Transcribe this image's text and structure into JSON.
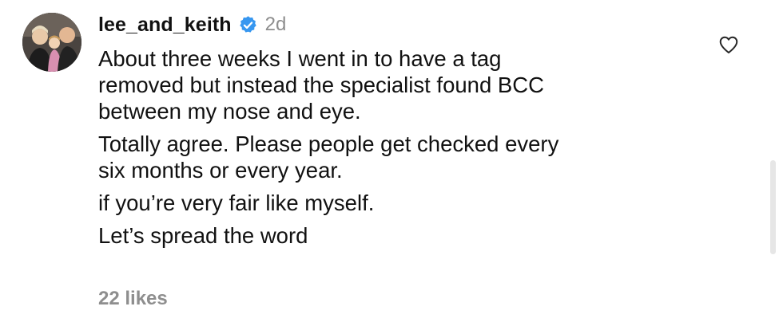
{
  "comment": {
    "username": "lee_and_keith",
    "verified": true,
    "timestamp": "2d",
    "paragraphs": [
      "About three weeks I went in to have a tag\nremoved but instead the specialist found BCC\nbetween my nose and eye.",
      "Totally agree. Please people get checked every\nsix months or every year.",
      "if you’re very fair like myself.",
      "Let’s spread the word"
    ],
    "likes_label": "22 likes",
    "like_icon": "heart-outline-icon",
    "verified_icon": "verified-badge-icon"
  },
  "colors": {
    "text": "#111111",
    "muted": "#8e8e8e",
    "verified_blue": "#3797f0",
    "background": "#ffffff"
  }
}
